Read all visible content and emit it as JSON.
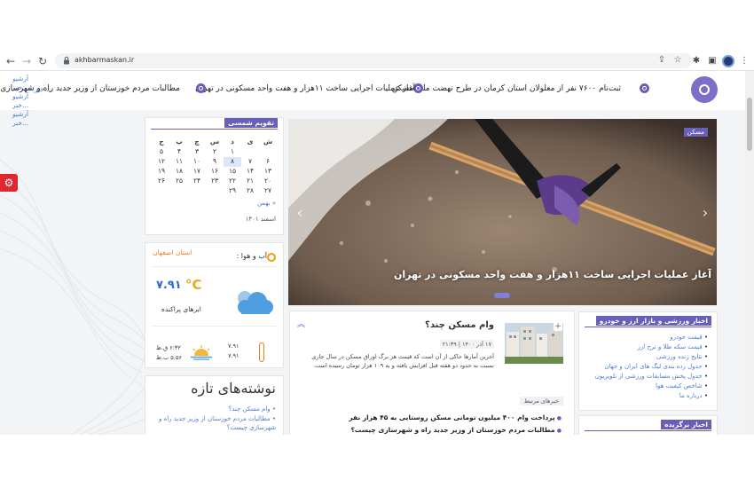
{
  "browser": {
    "url": "akhbarmaskan.ir"
  },
  "ticker": {
    "items": [
      "ثبت‌نام ۷۶۰۰ نفر از معلولان استان کرمان در طرح نهضت ملی مسکن",
      "آغاز عملیات اجرایی ساخت ۱۱هزار و هفت واحد مسکونی در تهران",
      "مطالبات مردم خوزستان از وزیر جدید راه و شهرسازی"
    ]
  },
  "archive": {
    "items": [
      "آرشیو",
      "خبر...",
      "آرشیو",
      "خبر...",
      "آرشیو",
      "خبر..."
    ]
  },
  "calendar": {
    "title": "تقویم شمسی",
    "weekdays": [
      "ش",
      "ی",
      "د",
      "س",
      "چ",
      "پ",
      "ج"
    ],
    "rows": [
      [
        "",
        "",
        "۱",
        "۲",
        "۳",
        "۴",
        "۵"
      ],
      [
        "۶",
        "۷",
        "۸",
        "۹",
        "۱۰",
        "۱۱",
        "۱۲"
      ],
      [
        "۱۳",
        "۱۴",
        "۱۵",
        "۱۶",
        "۱۷",
        "۱۸",
        "۱۹"
      ],
      [
        "۲۰",
        "۲۱",
        "۲۲",
        "۲۳",
        "۲۴",
        "۲۵",
        "۲۶"
      ],
      [
        "۲۷",
        "۲۸",
        "۲۹",
        "",
        "",
        "",
        ""
      ]
    ],
    "prev_month_link": "« بهمن",
    "date_label": "اسفند ۱۴۰۱"
  },
  "weather": {
    "title": "آب و هوا :",
    "province": "استان اصفهان",
    "temperature": "۷.۹۱",
    "unit": "°C",
    "description": "ابرهای پراکنده",
    "min_temp": "۷.۹۱",
    "max_temp": "۷.۹۱",
    "sunrise": "۶:۳۲ ق.ظ",
    "sunset": "۵:۵۶ ب.ظ"
  },
  "writings": {
    "title": "نوشته‌های تازه",
    "items": [
      "• وام مسکن چند؟",
      "• مطالبات مردم خوزستان از وزیر جدید راه و شهرسازی چیست؟"
    ]
  },
  "slider": {
    "tag": "مسکن",
    "caption": "آغاز عملیات اجرایی ساخت ۱۱هزار و هفت واحد مسکونی در تهران"
  },
  "loan_article": {
    "title": "وام مسکن چند؟",
    "meta": "۱۷ آذر ۱۴۰۰ | ۲۱:۳۹",
    "text": "آخرین آمارها حاکی از آن است که قیمت هر برگ اوراق مسکن در سال جاری نسبت به حدود دو هفته قبل افزایش یافته و به ۱۰۹ هزار تومان رسیده است.",
    "related_label": "خبرهای مرتبط",
    "related": [
      "پرداخت وام ۴۰۰ میلیون تومانی مسکن روستایی به ۴۵ هزار نفر",
      "مطالبات مردم خوزستان از وزیر جدید راه و شهرسازی چیست؟"
    ]
  },
  "sports": {
    "title": "اخبار ورزشی و بازار ارز و خودرو",
    "items": [
      "قیمت خودرو",
      "قیمت سکه طلا و نرخ ارز",
      "نتایج زنده ورزشی",
      "جدول رده بندی لیگ های ایران و جهان",
      "جدول پخش مسابقات ورزشی از تلویزیون",
      "شاخص کیفیت هوا",
      "درباره ما"
    ]
  },
  "featured": {
    "title": "اخبار برگزیده"
  }
}
